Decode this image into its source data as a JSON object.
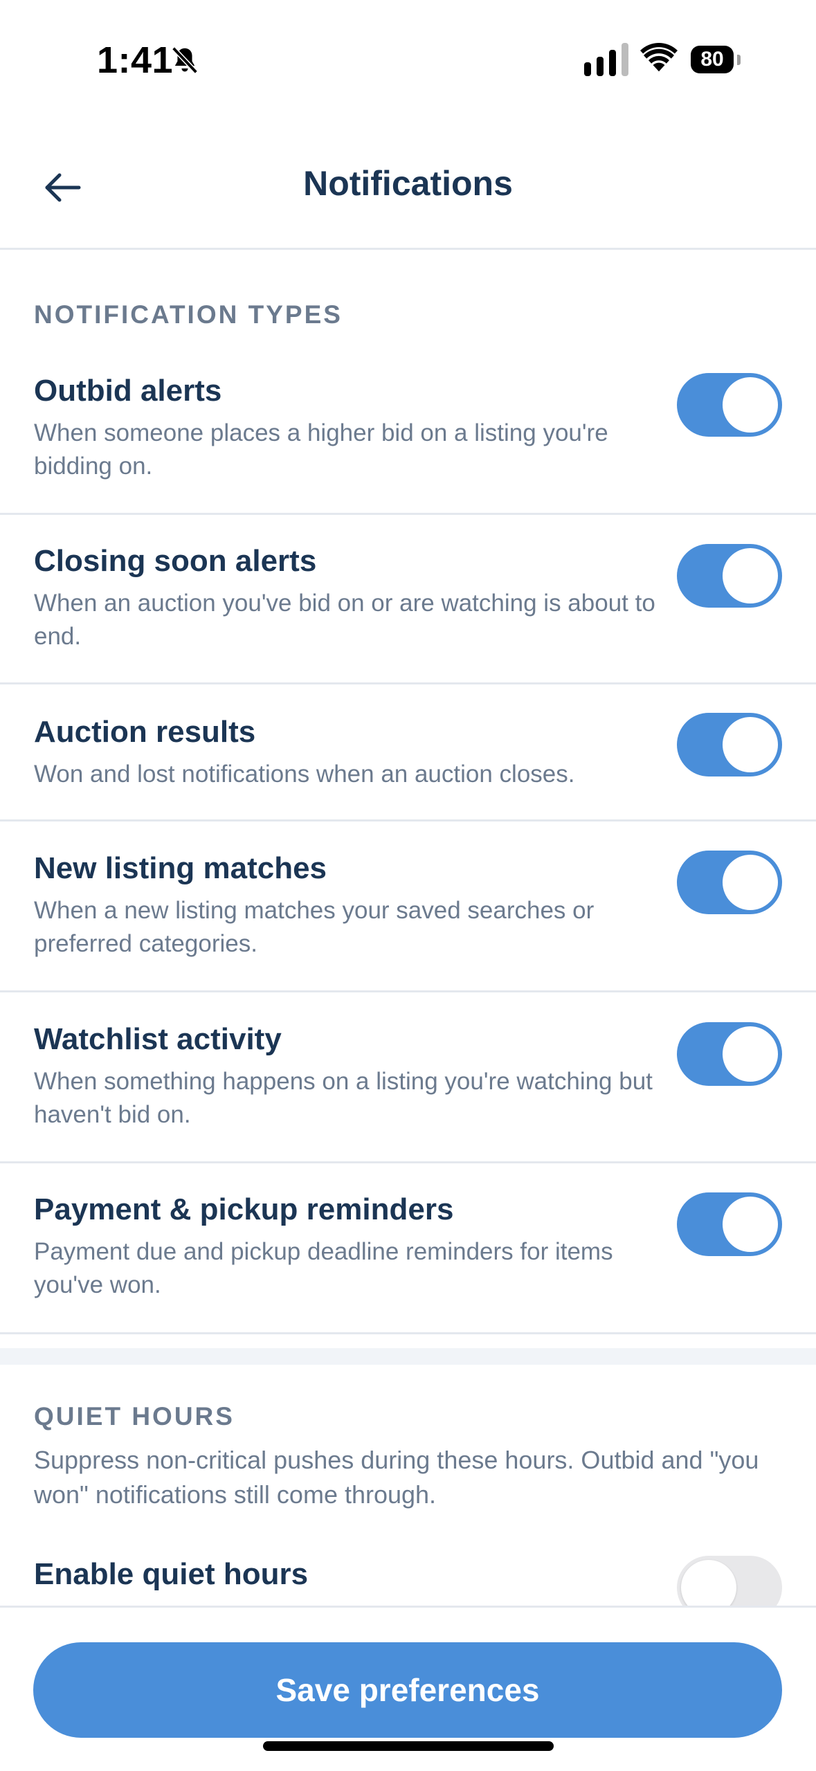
{
  "status_bar": {
    "time": "1:41",
    "battery": "80"
  },
  "header": {
    "title": "Notifications"
  },
  "notification_types": {
    "label": "NOTIFICATION TYPES",
    "items": [
      {
        "title": "Outbid alerts",
        "desc": "When someone places a higher bid on a listing you're bidding on.",
        "enabled": true
      },
      {
        "title": "Closing soon alerts",
        "desc": "When an auction you've bid on or are watching is about to end.",
        "enabled": true
      },
      {
        "title": "Auction results",
        "desc": "Won and lost notifications when an auction closes.",
        "enabled": true
      },
      {
        "title": "New listing matches",
        "desc": "When a new listing matches your saved searches or preferred categories.",
        "enabled": true
      },
      {
        "title": "Watchlist activity",
        "desc": "When something happens on a listing you're watching but haven't bid on.",
        "enabled": true
      },
      {
        "title": "Payment & pickup reminders",
        "desc": "Payment due and pickup deadline reminders for items you've won.",
        "enabled": true
      }
    ]
  },
  "quiet_hours": {
    "label": "QUIET HOURS",
    "desc": "Suppress non-critical pushes during these hours. Outbid and \"you won\" notifications still come through.",
    "enable_label": "Enable quiet hours",
    "enabled": false
  },
  "footer": {
    "save_label": "Save preferences"
  },
  "colors": {
    "accent": "#4a8ed9",
    "title_text": "#1b3554",
    "secondary_text": "#6b7a8e",
    "divider": "#e4e8ee"
  }
}
